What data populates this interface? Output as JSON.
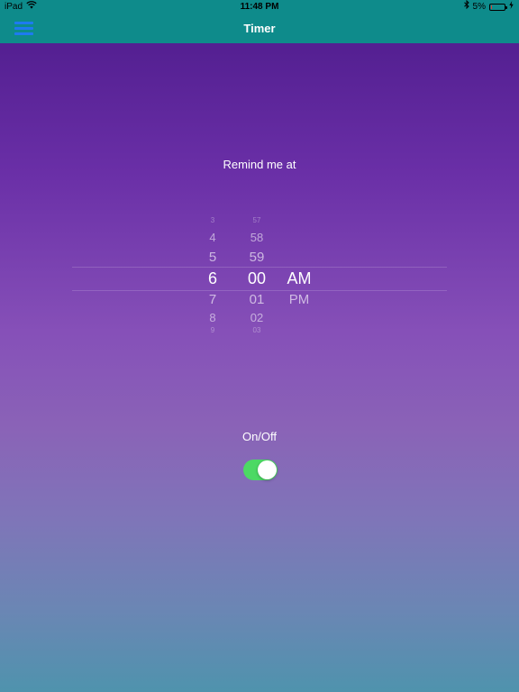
{
  "status_bar": {
    "device": "iPad",
    "time": "11:48 PM",
    "battery_percent": "5%",
    "battery_level": 0.05,
    "icons": [
      "wifi-icon",
      "bluetooth-icon",
      "battery-icon",
      "charging-icon"
    ]
  },
  "nav_bar": {
    "title": "Timer",
    "menu_icon": "hamburger-menu-icon",
    "menu_color": "#1d7bf0",
    "background": "#0e8b8b"
  },
  "reminder": {
    "label": "Remind me at"
  },
  "picker": {
    "hours": [
      "3",
      "4",
      "5",
      "6",
      "7",
      "8",
      "9"
    ],
    "minutes": [
      "57",
      "58",
      "59",
      "00",
      "01",
      "02",
      "03"
    ],
    "periods": [
      "AM",
      "PM"
    ],
    "selected": {
      "hour": "6",
      "minute": "00",
      "period": "AM"
    }
  },
  "toggle": {
    "label": "On/Off",
    "state": "on",
    "on_color": "#4cd964"
  }
}
